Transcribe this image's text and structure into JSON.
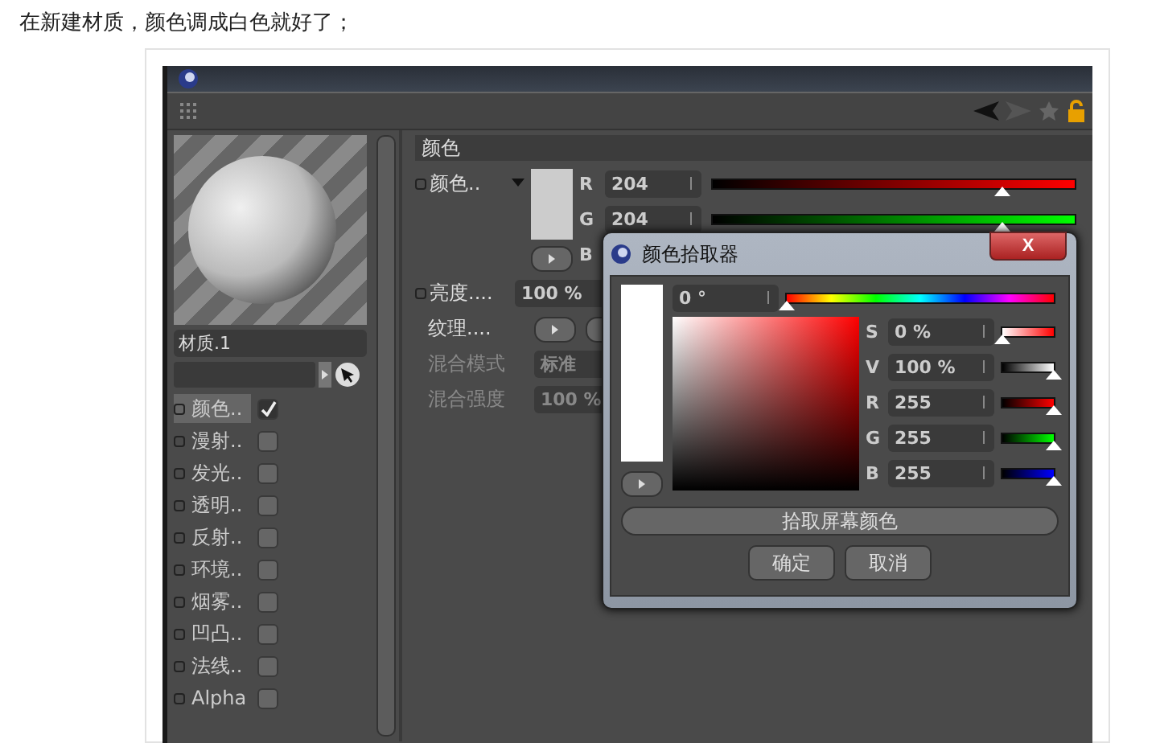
{
  "caption": "在新建材质，颜色调成白色就好了；",
  "material": {
    "name": "材质.1"
  },
  "channels": [
    {
      "label": "颜色..",
      "checked": true,
      "selected": true
    },
    {
      "label": "漫射..",
      "checked": false,
      "selected": false
    },
    {
      "label": "发光..",
      "checked": false,
      "selected": false
    },
    {
      "label": "透明..",
      "checked": false,
      "selected": false
    },
    {
      "label": "反射..",
      "checked": false,
      "selected": false
    },
    {
      "label": "环境..",
      "checked": false,
      "selected": false
    },
    {
      "label": "烟雾..",
      "checked": false,
      "selected": false
    },
    {
      "label": "凹凸..",
      "checked": false,
      "selected": false
    },
    {
      "label": "法线..",
      "checked": false,
      "selected": false
    },
    {
      "label": "Alpha",
      "checked": false,
      "selected": false
    }
  ],
  "panel": {
    "section": "颜色",
    "color_label": "颜色..",
    "rgb": [
      {
        "label": "R",
        "value": "204",
        "level": 0.8,
        "kind": "red"
      },
      {
        "label": "G",
        "value": "204",
        "level": 0.8,
        "kind": "green"
      },
      {
        "label": "B",
        "kind": "blue"
      }
    ],
    "brightness_label": "亮度....",
    "brightness_value": "100 %",
    "texture_label": "纹理....",
    "blend_mode_label": "混合模式",
    "blend_mode_value": "标准",
    "blend_strength_label": "混合强度",
    "blend_strength_value": "100 %"
  },
  "dialog": {
    "title": "颜色拾取器",
    "close": "X",
    "hue": {
      "value": "0 °",
      "level": 0
    },
    "sliders": [
      {
        "label": "S",
        "value": "0 %",
        "level": 0,
        "kind": "sat"
      },
      {
        "label": "V",
        "value": "100 %",
        "level": 1,
        "kind": "val"
      },
      {
        "label": "R",
        "value": "255",
        "level": 1,
        "kind": "red"
      },
      {
        "label": "G",
        "value": "255",
        "level": 1,
        "kind": "green"
      },
      {
        "label": "B",
        "value": "255",
        "level": 1,
        "kind": "blue"
      }
    ],
    "pick_button": "拾取屏幕颜色",
    "buttons": [
      "确定",
      "取消"
    ]
  }
}
